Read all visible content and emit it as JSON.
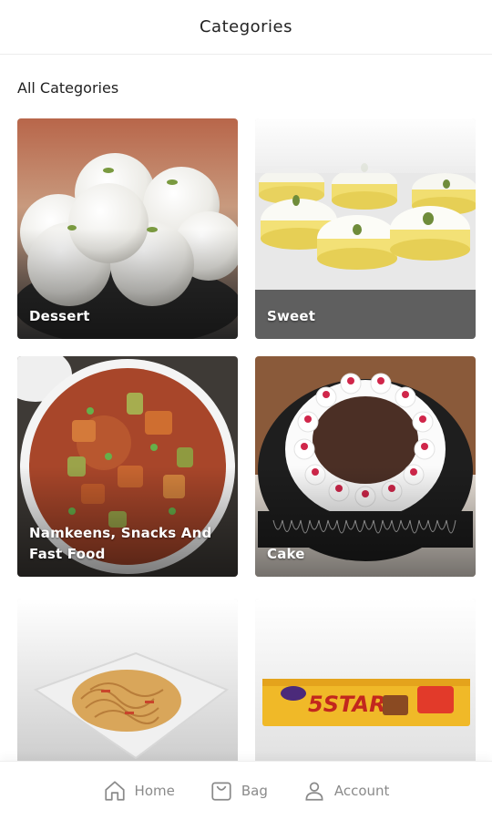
{
  "header": {
    "title": "Categories"
  },
  "section": {
    "title": "All Categories"
  },
  "categories": [
    {
      "label": "Dessert"
    },
    {
      "label": "Sweet"
    },
    {
      "label": "Namkeens, Snacks And Fast Food"
    },
    {
      "label": "Cake"
    },
    {
      "label": ""
    },
    {
      "label": ""
    }
  ],
  "bottom_nav": {
    "items": [
      {
        "label": "Home",
        "icon": "home-icon"
      },
      {
        "label": "Bag",
        "icon": "bag-icon"
      },
      {
        "label": "Account",
        "icon": "account-icon"
      }
    ]
  },
  "colors": {
    "nav_text": "#8a8a8a",
    "title_text": "#222222",
    "card_label": "#ffffff"
  },
  "card_bar_text": "5STAR"
}
